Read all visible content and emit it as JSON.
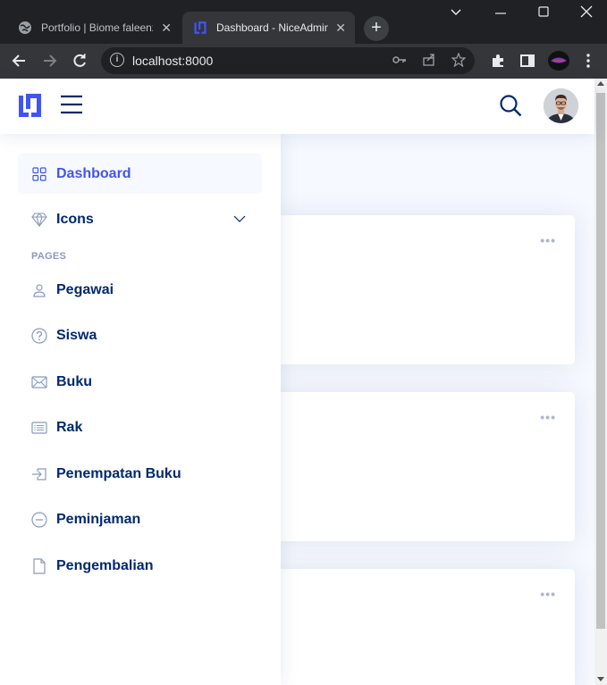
{
  "browser": {
    "tabs": [
      {
        "title": "Portfolio | Biome faleenz",
        "close": "✕"
      },
      {
        "title": "Dashboard - NiceAdmin",
        "close": "✕"
      }
    ],
    "new_tab": "+",
    "url": "localhost:8000"
  },
  "sidebar": {
    "items": [
      {
        "label": "Dashboard",
        "icon": "grid-icon"
      },
      {
        "label": "Icons",
        "icon": "gem-icon"
      }
    ],
    "heading": "PAGES",
    "pages": [
      {
        "label": "Pegawai",
        "icon": "person-icon"
      },
      {
        "label": "Siswa",
        "icon": "question-circle-icon"
      },
      {
        "label": "Buku",
        "icon": "envelope-icon"
      },
      {
        "label": "Rak",
        "icon": "card-list-icon"
      },
      {
        "label": "Penempatan Buku",
        "icon": "box-arrow-in-right-icon"
      },
      {
        "label": "Peminjaman",
        "icon": "dash-circle-icon"
      },
      {
        "label": "Pengembalian",
        "icon": "file-icon"
      }
    ]
  },
  "cards": [
    {
      "menu": "•••"
    },
    {
      "menu": "•••"
    },
    {
      "menu": "•••"
    }
  ],
  "colors": {
    "accent": "#4154f1",
    "nav_text": "#012970",
    "heading": "#899bbd",
    "background": "#f6f9ff"
  }
}
